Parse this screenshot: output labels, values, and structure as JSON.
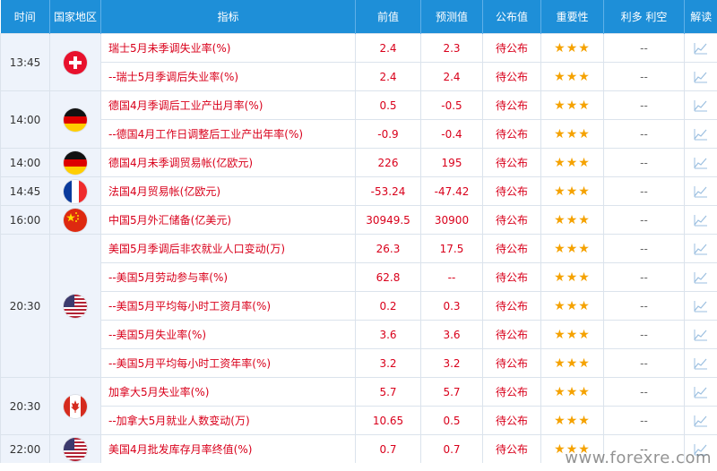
{
  "header": {
    "time": "时间",
    "region": "国家地区",
    "indicator": "指标",
    "previous": "前值",
    "forecast": "预测值",
    "actual": "公布值",
    "importance": "重要性",
    "impact": "利多 利空",
    "interpret": "解读"
  },
  "stars": "★★★",
  "pending": "待公布",
  "impact_value": "--",
  "groups": [
    {
      "time": "13:45",
      "flag": "switzerland-flag-icon",
      "rows": [
        {
          "indicator": "瑞士5月未季调失业率(%)",
          "previous": "2.4",
          "forecast": "2.3"
        },
        {
          "indicator": "--瑞士5月季调后失业率(%)",
          "previous": "2.4",
          "forecast": "2.4"
        }
      ]
    },
    {
      "time": "14:00",
      "flag": "germany-flag-icon",
      "rows": [
        {
          "indicator": "德国4月季调后工业产出月率(%)",
          "previous": "0.5",
          "forecast": "-0.5"
        },
        {
          "indicator": "--德国4月工作日调整后工业产出年率(%)",
          "previous": "-0.9",
          "forecast": "-0.4"
        }
      ]
    },
    {
      "time": "14:00",
      "flag": "germany-flag-icon",
      "rows": [
        {
          "indicator": "德国4月未季调贸易帐(亿欧元)",
          "previous": "226",
          "forecast": "195"
        }
      ]
    },
    {
      "time": "14:45",
      "flag": "france-flag-icon",
      "rows": [
        {
          "indicator": "法国4月贸易帐(亿欧元)",
          "previous": "-53.24",
          "forecast": "-47.42"
        }
      ]
    },
    {
      "time": "16:00",
      "flag": "china-flag-icon",
      "rows": [
        {
          "indicator": "中国5月外汇储备(亿美元)",
          "previous": "30949.5",
          "forecast": "30900"
        }
      ]
    },
    {
      "time": "20:30",
      "flag": "usa-flag-icon",
      "rows": [
        {
          "indicator": "美国5月季调后非农就业人口变动(万)",
          "previous": "26.3",
          "forecast": "17.5"
        },
        {
          "indicator": "--美国5月劳动参与率(%)",
          "previous": "62.8",
          "forecast": "--"
        },
        {
          "indicator": "--美国5月平均每小时工资月率(%)",
          "previous": "0.2",
          "forecast": "0.3"
        },
        {
          "indicator": "--美国5月失业率(%)",
          "previous": "3.6",
          "forecast": "3.6"
        },
        {
          "indicator": "--美国5月平均每小时工资年率(%)",
          "previous": "3.2",
          "forecast": "3.2"
        }
      ]
    },
    {
      "time": "20:30",
      "flag": "canada-flag-icon",
      "rows": [
        {
          "indicator": "加拿大5月失业率(%)",
          "previous": "5.7",
          "forecast": "5.7"
        },
        {
          "indicator": "--加拿大5月就业人数变动(万)",
          "previous": "10.65",
          "forecast": "0.5"
        }
      ]
    },
    {
      "time": "22:00",
      "flag": "usa-flag-icon",
      "rows": [
        {
          "indicator": "美国4月批发库存月率终值(%)",
          "previous": "0.7",
          "forecast": "0.7"
        }
      ]
    }
  ],
  "watermark": "www.forexre.com",
  "colors": {
    "header": "#1e8fd8",
    "text_red": "#d9001b",
    "star": "#f5a200",
    "side_bg": "#eef3fb"
  }
}
